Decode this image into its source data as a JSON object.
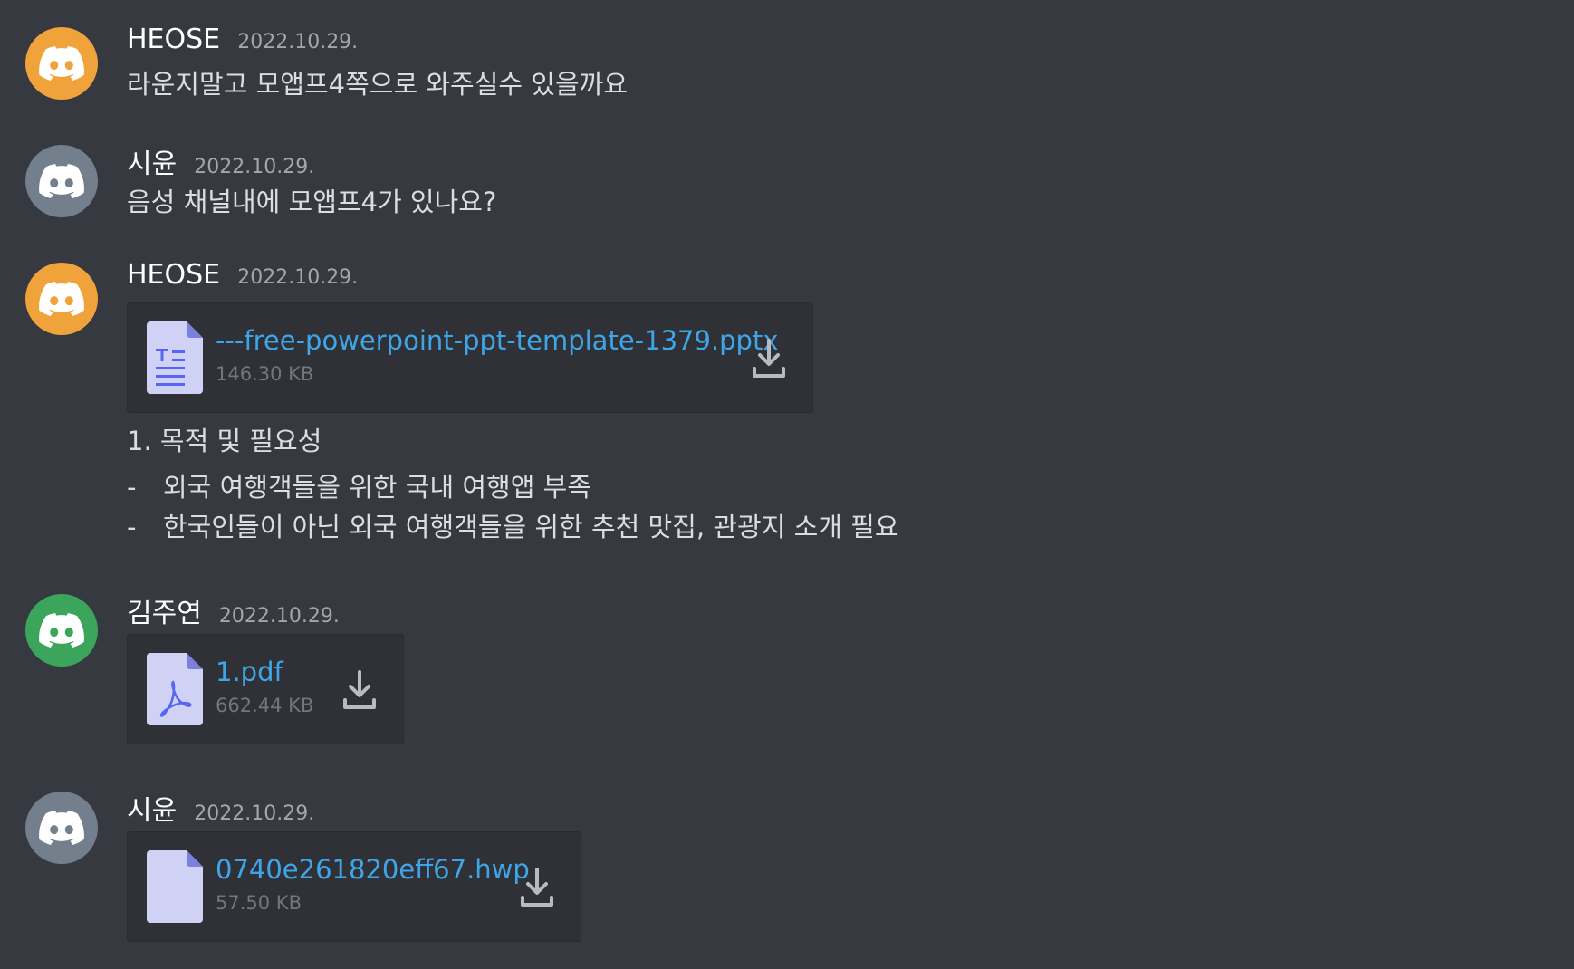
{
  "colors": {
    "background": "#36393f",
    "avatar_orange": "#f0a33b",
    "avatar_gray": "#747f8d",
    "avatar_green": "#3ba55c",
    "link": "#3ea6e8",
    "file_icon": "#cfd1f5"
  },
  "messages": [
    {
      "username": "HEOSE",
      "timestamp": "2022.10.29.",
      "avatar_icon": "discord-logo-icon",
      "text": "라운지말고 모앱프4쪽으로 와주실수 있을까요"
    },
    {
      "username": "시윤",
      "timestamp": "2022.10.29.",
      "avatar_icon": "discord-logo-icon",
      "text": "음성 채널내에 모앱프4가 있나요?"
    },
    {
      "username": "HEOSE",
      "timestamp": "2022.10.29.",
      "avatar_icon": "discord-logo-icon",
      "attachment": {
        "file_name": "---free-powerpoint-ppt-template-1379.pptx",
        "file_size": "146.30 KB",
        "icon": "document-file-icon"
      },
      "heading": "1. 목적 및 필요성",
      "bullets": [
        {
          "dash": "-",
          "text": "외국 여행객들을 위한 국내 여행앱 부족"
        },
        {
          "dash": "-",
          "text": "한국인들이 아닌 외국 여행객들을 위한 추천 맛집, 관광지 소개 필요"
        }
      ]
    },
    {
      "username": "김주연",
      "timestamp": "2022.10.29.",
      "avatar_icon": "discord-logo-icon",
      "attachment": {
        "file_name": "1.pdf",
        "file_size": "662.44 KB",
        "icon": "pdf-file-icon"
      }
    },
    {
      "username": "시윤",
      "timestamp": "2022.10.29.",
      "avatar_icon": "discord-logo-icon",
      "attachment": {
        "file_name": "0740e261820eff67.hwp",
        "file_size": "57.50 KB",
        "icon": "blank-file-icon"
      }
    }
  ]
}
